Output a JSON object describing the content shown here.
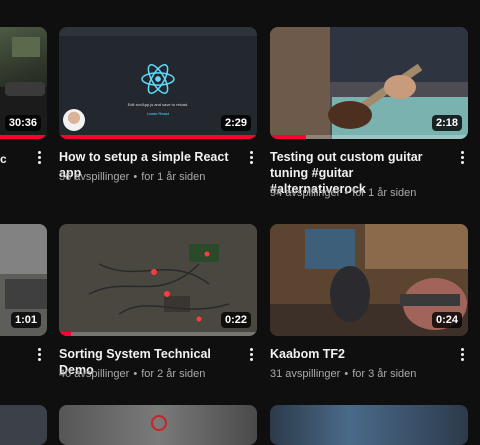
{
  "videos": [
    {
      "title": "",
      "views": "",
      "age": "",
      "duration": "30:36",
      "progress_percent": 100
    },
    {
      "title": "How to setup a simple React app",
      "views": "36 avspillinger",
      "age": "for 1 år siden",
      "duration": "2:29",
      "progress_percent": 100
    },
    {
      "title": "Testing out custom guitar tuning #guitar #alternativerock",
      "views": "94 avspillinger",
      "age": "for 1 år siden",
      "duration": "2:18",
      "progress_percent": 18
    },
    {
      "title": "",
      "views": "",
      "age": "",
      "duration": "1:01",
      "progress_percent": 0
    },
    {
      "title": "Sorting System Technical Demo",
      "views": "40 avspillinger",
      "age": "for 2 år siden",
      "duration": "0:22",
      "progress_percent": 6
    },
    {
      "title": "Kaabom TF2",
      "views": "31 avspillinger",
      "age": "for 3 år siden",
      "duration": "0:24",
      "progress_percent": 0
    }
  ],
  "react_thumb": {
    "caption": "Edit src/App.js and save to reload.",
    "link": "Learn React"
  },
  "colors": {
    "progress": "#ff0033",
    "background": "#0f0f0f",
    "react": "#61dafb"
  },
  "icons": [
    "more-vert-icon",
    "react-logo-icon"
  ]
}
